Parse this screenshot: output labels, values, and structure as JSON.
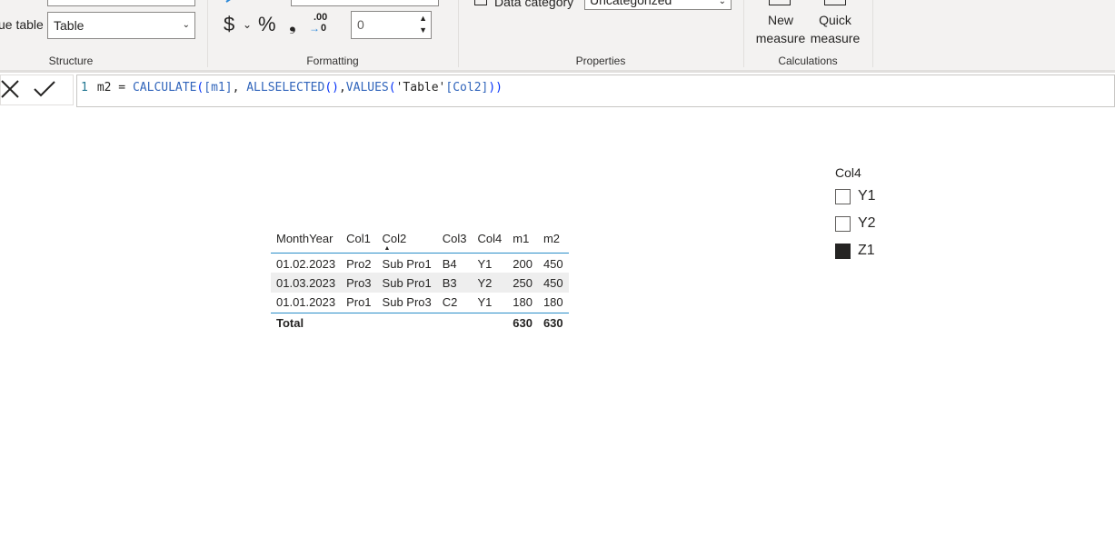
{
  "ribbon": {
    "structure": {
      "home_table_label": "ue table",
      "home_table_value": "Table",
      "group_label": "Structure"
    },
    "formatting": {
      "currency_symbol": "$",
      "percent_symbol": "%",
      "comma_symbol": "❟",
      "decimal_symbol": ".00",
      "decimal_places": "0",
      "group_label": "Formatting"
    },
    "properties": {
      "data_category_label": "Data category",
      "data_category_value": "Uncategorized",
      "group_label": "Properties"
    },
    "calculations": {
      "new_measure_line1": "New",
      "new_measure_line2": "measure",
      "quick_measure_line1": "Quick",
      "quick_measure_line2": "measure",
      "group_label": "Calculations"
    }
  },
  "formula_bar": {
    "line_number": "1",
    "measure_name": "m2 = ",
    "fn_calculate": "CALCULATE",
    "paren_open": "(",
    "arg_m1": "[m1]",
    "sep1": ", ",
    "fn_allselected": "ALLSELECTED",
    "paren_empty": "()",
    "sep2": ",",
    "fn_values": "VALUES",
    "paren_open2": "(",
    "table_ref": "'Table'",
    "col_ref": "[Col2]",
    "paren_close": "))"
  },
  "table_visual": {
    "columns": [
      "MonthYear",
      "Col1",
      "Col2",
      "Col3",
      "Col4",
      "m1",
      "m2"
    ],
    "rows": [
      [
        "01.02.2023",
        "Pro2",
        "Sub Pro1",
        "B4",
        "Y1",
        "200",
        "450"
      ],
      [
        "01.03.2023",
        "Pro3",
        "Sub Pro1",
        "B3",
        "Y2",
        "250",
        "450"
      ],
      [
        "01.01.2023",
        "Pro1",
        "Sub Pro3",
        "C2",
        "Y1",
        "180",
        "180"
      ]
    ],
    "total_label": "Total",
    "total_m1": "630",
    "total_m2": "630",
    "sorted_column": "Col2"
  },
  "slicer": {
    "title": "Col4",
    "items": [
      {
        "label": "Y1",
        "checked": false
      },
      {
        "label": "Y2",
        "checked": false
      },
      {
        "label": "Z1",
        "checked": true
      }
    ]
  }
}
